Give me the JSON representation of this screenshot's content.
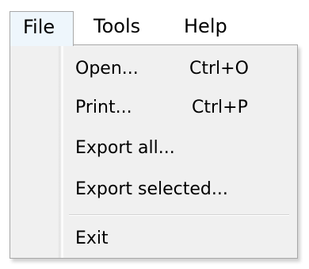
{
  "menubar": {
    "items": [
      {
        "label": "File"
      },
      {
        "label": "Tools"
      },
      {
        "label": "Help"
      }
    ]
  },
  "file_menu": {
    "items": [
      {
        "label": "Open...",
        "shortcut": "Ctrl+O"
      },
      {
        "label": "Print...",
        "shortcut": "Ctrl+P"
      },
      {
        "label": "Export all...",
        "shortcut": ""
      },
      {
        "label": "Export selected...",
        "shortcut": ""
      },
      {
        "label": "Exit",
        "shortcut": ""
      }
    ]
  }
}
